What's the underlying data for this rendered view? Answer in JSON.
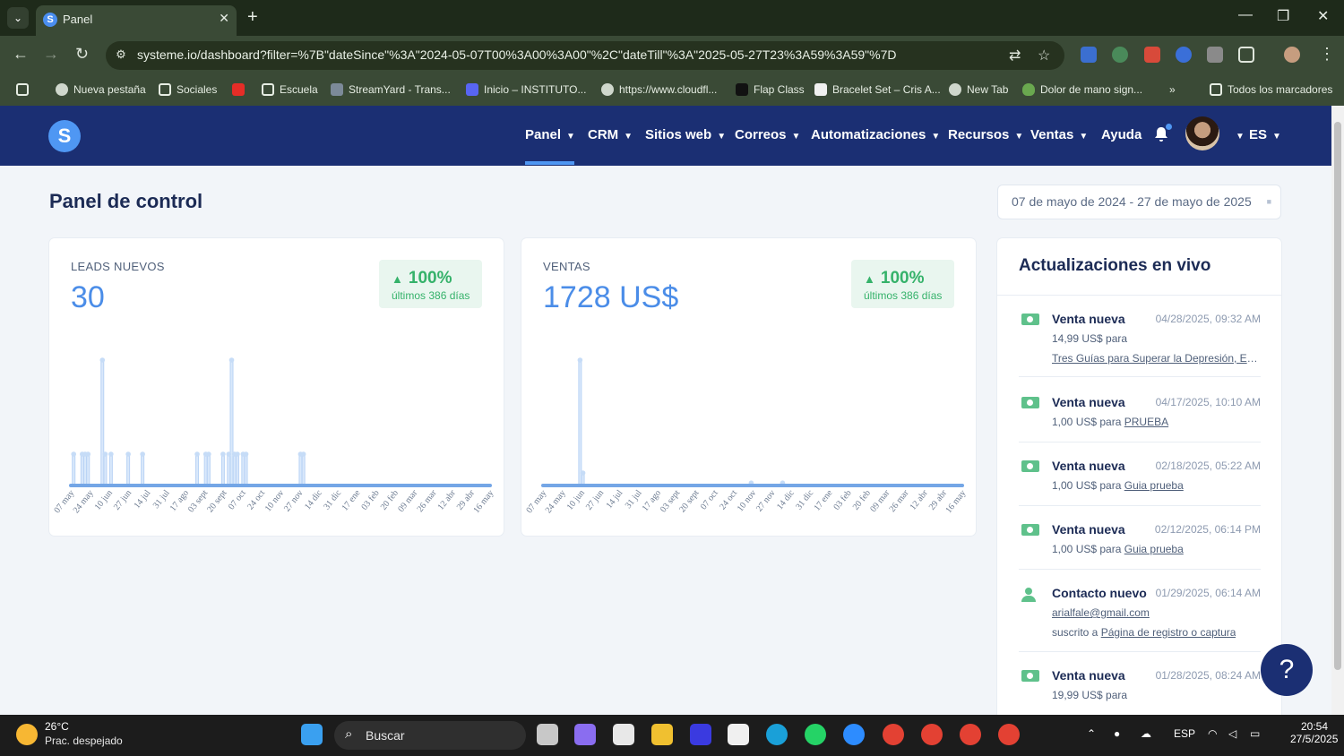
{
  "browser": {
    "tab_title": "Panel",
    "url": "systeme.io/dashboard?filter=%7B\"dateSince\"%3A\"2024-05-07T00%3A00%3A00\"%2C\"dateTill\"%3A\"2025-05-27T23%3A59%3A59\"%7D",
    "bookmarks": [
      "Nueva pestaña",
      "Sociales",
      "Escuela",
      "StreamYard - Trans...",
      "Inicio – INSTITUTO...",
      "https://www.cloudfl...",
      "Flap Class",
      "Bracelet Set – Cris A...",
      "New Tab",
      "Dolor de mano sign..."
    ],
    "all_bookmarks": "Todos los marcadores"
  },
  "app": {
    "logo": "S",
    "menu": [
      "Panel",
      "CRM",
      "Sitios web",
      "Correos",
      "Automatizaciones",
      "Recursos",
      "Ventas",
      "Ayuda"
    ],
    "lang": "ES"
  },
  "page": {
    "title": "Panel de control",
    "date_range": "07 de mayo de 2024 - 27 de mayo de 2025"
  },
  "cards": {
    "leads": {
      "label": "LEADS NUEVOS",
      "value": "30",
      "change": "100%",
      "period": "últimos 386 días"
    },
    "sales": {
      "label": "VENTAS",
      "value": "1728 US$",
      "change": "100%",
      "period": "últimos 386 días"
    }
  },
  "chart_data": [
    {
      "type": "area",
      "series": [
        {
          "values": [
            0,
            1,
            0,
            0,
            1,
            1,
            1,
            0,
            0,
            0,
            0,
            4,
            1,
            0,
            1,
            0,
            0,
            0,
            0,
            0,
            1,
            0,
            0,
            0,
            0,
            1,
            0,
            0,
            0,
            0,
            0,
            0,
            0,
            0,
            0,
            0,
            0,
            0,
            0,
            0,
            0,
            0,
            0,
            0,
            1,
            0,
            0,
            1,
            1,
            0,
            0,
            0,
            0,
            1,
            0,
            1,
            4,
            1,
            1,
            0,
            1,
            1,
            0,
            0,
            0,
            0,
            0,
            0,
            0,
            0,
            0,
            0,
            0,
            0,
            0,
            0,
            0,
            0,
            0,
            0,
            1,
            1,
            0,
            0,
            0,
            0,
            0,
            0,
            0,
            0,
            0,
            0,
            0,
            0,
            0,
            0,
            0,
            0,
            0,
            0,
            0,
            0,
            0,
            0,
            0,
            0,
            0,
            0,
            0,
            0,
            0,
            0,
            0,
            0,
            0,
            0,
            0,
            0,
            0,
            0,
            0,
            0,
            0,
            0,
            0,
            0,
            0,
            0,
            0,
            0,
            0,
            0,
            0,
            0,
            0,
            0,
            0,
            0,
            0,
            0,
            0,
            0,
            0,
            0,
            0,
            0,
            0
          ]
        }
      ],
      "x_ticks": [
        "07 may",
        "24 may",
        "10 jun",
        "27 jun",
        "14 jul",
        "31 jul",
        "17 ago",
        "03 sept",
        "20 sept",
        "07 oct",
        "24 oct",
        "10 nov",
        "27 nov",
        "14 dic",
        "31 dic",
        "17 ene",
        "03 feb",
        "20 feb",
        "09 mar",
        "26 mar",
        "12 abr",
        "29 abr",
        "16 may"
      ]
    },
    {
      "type": "area",
      "series": [
        {
          "values": [
            0,
            0,
            0,
            0,
            0,
            0,
            0,
            0,
            0,
            0,
            0,
            0,
            0,
            100,
            10,
            0,
            0,
            0,
            0,
            0,
            0,
            0,
            0,
            0,
            0,
            0,
            0,
            0,
            0,
            0,
            0,
            0,
            0,
            0,
            0,
            0,
            0,
            0,
            0,
            0,
            0,
            0,
            0,
            0,
            0,
            0,
            0,
            0,
            0,
            0,
            0,
            0,
            0,
            0,
            0,
            0,
            0,
            0,
            0,
            0,
            0,
            0,
            0,
            0,
            0,
            0,
            0,
            0,
            0,
            0,
            0,
            0,
            0,
            2,
            0,
            0,
            0,
            0,
            0,
            0,
            0,
            0,
            0,
            0,
            2,
            0,
            0,
            0,
            0,
            0,
            0,
            0,
            0,
            0,
            0,
            0,
            0,
            0,
            0,
            0,
            0,
            0,
            0,
            0,
            0,
            0,
            0,
            0,
            0,
            0,
            0,
            0,
            0,
            0,
            0,
            0,
            0,
            0,
            0,
            0,
            0,
            0,
            0,
            0,
            0,
            0,
            0,
            0,
            0,
            0,
            0,
            0,
            0,
            0,
            0,
            0,
            0,
            0,
            0,
            0,
            0,
            0,
            0,
            0,
            0,
            0,
            0,
            0
          ]
        }
      ],
      "x_ticks": [
        "07 may",
        "24 may",
        "10 jun",
        "27 jun",
        "14 jul",
        "31 jul",
        "17 ago",
        "03 sept",
        "20 sept",
        "07 oct",
        "24 oct",
        "10 nov",
        "27 nov",
        "14 dic",
        "31 dic",
        "17 ene",
        "03 feb",
        "20 feb",
        "09 mar",
        "26 mar",
        "12 abr",
        "29 abr",
        "16 may"
      ]
    }
  ],
  "live": {
    "title": "Actualizaciones en vivo",
    "items": [
      {
        "type": "Venta nueva",
        "date": "04/28/2025, 09:32 AM",
        "line1": "14,99 US$ para",
        "line2_link": "Tres Guías para Superar la Depresión, Es..."
      },
      {
        "type": "Venta nueva",
        "date": "04/17/2025, 10:10 AM",
        "line1": "1,00 US$ para",
        "link": "PRUEBA"
      },
      {
        "type": "Venta nueva",
        "date": "02/18/2025, 05:22 AM",
        "line1": "1,00 US$ para",
        "link": "Guia prueba"
      },
      {
        "type": "Venta nueva",
        "date": "02/12/2025, 06:14 PM",
        "line1": "1,00 US$ para",
        "link": "Guia prueba"
      },
      {
        "type": "Contacto nuevo",
        "date": "01/29/2025, 06:14 AM",
        "line1_link": "arialfale@gmail.com",
        "line2": "suscrito a",
        "line2_link": "Página de registro o captura"
      },
      {
        "type": "Venta nueva",
        "date": "01/28/2025, 08:24 AM",
        "line1": "19,99 US$ para"
      }
    ]
  },
  "help": "?",
  "taskbar": {
    "temp": "26°C",
    "weather": "Prac. despejado",
    "search": "Buscar",
    "lang": "ESP",
    "time": "20:54",
    "date": "27/5/2025"
  },
  "colors": {
    "nav": "#1b2f73",
    "accent": "#4f97f3",
    "positive": "#35b26a"
  }
}
